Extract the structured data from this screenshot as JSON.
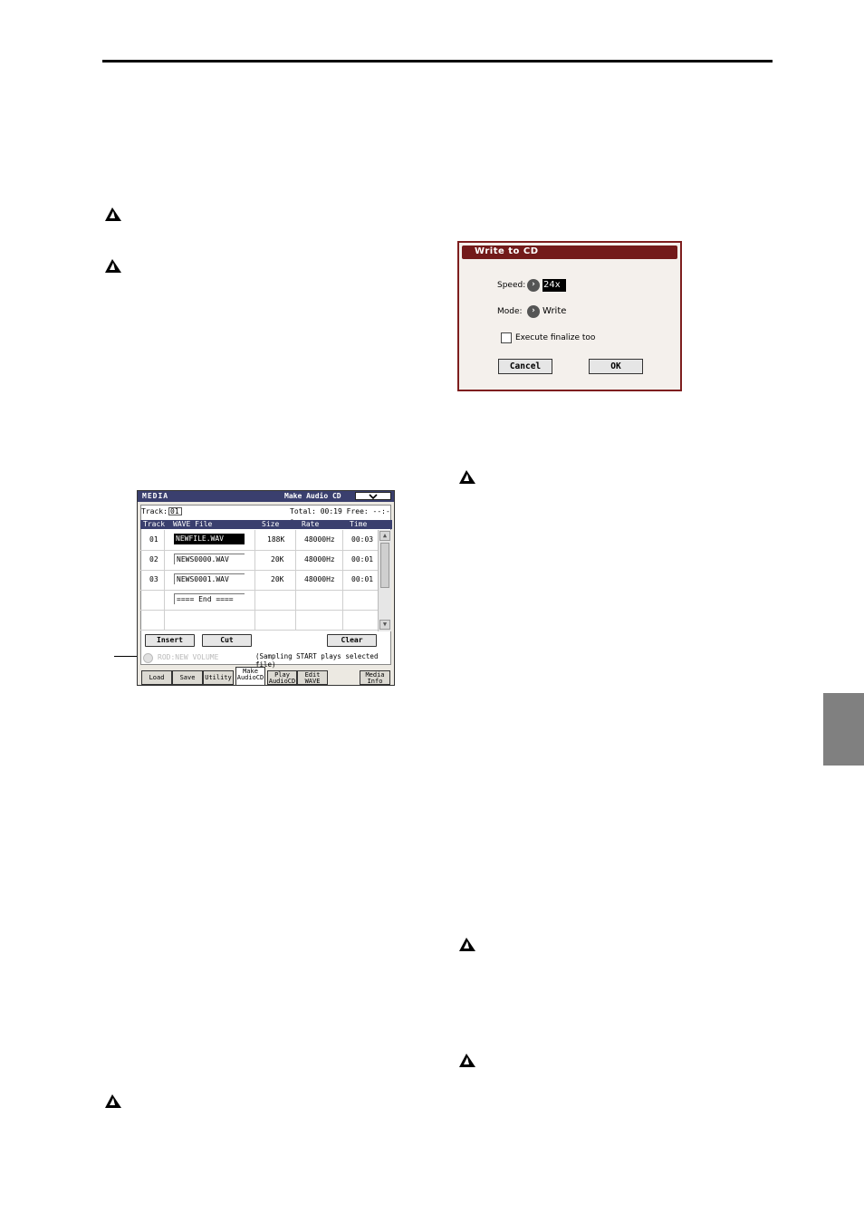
{
  "media_screen": {
    "title": "MEDIA",
    "page_title": "Make Audio CD",
    "track_label": "Track:",
    "track_value": "01",
    "total_text": "Total: 00:19 Free: --:--",
    "columns": [
      "Track",
      "WAVE File",
      "Size",
      "Rate",
      "Time"
    ],
    "rows": [
      {
        "track": "01",
        "file": "NEWFILE.WAV",
        "size": "188K",
        "rate": "48000Hz",
        "time": "00:03"
      },
      {
        "track": "02",
        "file": "NEWS0000.WAV",
        "size": "20K",
        "rate": "48000Hz",
        "time": "00:01"
      },
      {
        "track": "03",
        "file": "NEWS0001.WAV",
        "size": "20K",
        "rate": "48000Hz",
        "time": "00:01"
      }
    ],
    "end_marker": "==== End ====",
    "buttons": {
      "insert": "Insert",
      "cut": "Cut",
      "clear": "Clear"
    },
    "status_left": "ROD:NEW VOLUME",
    "status_right": "(Sampling START plays selected file)",
    "tabs": [
      {
        "label": "Load",
        "active": false
      },
      {
        "label": "Save",
        "active": false
      },
      {
        "label": "Utility",
        "active": false
      },
      {
        "label": "Make AudioCD",
        "active": true
      },
      {
        "label": "Play AudioCD",
        "active": false
      },
      {
        "label": "Edit WAVE",
        "active": false
      },
      {
        "label": "Media Info",
        "active": false
      }
    ]
  },
  "write_dialog": {
    "title": "Write to CD",
    "speed_label": "Speed:",
    "speed_value": "24x",
    "mode_label": "Mode:",
    "mode_value": "Write",
    "finalize_label": "Execute finalize too",
    "finalize_checked": false,
    "cancel_label": "Cancel",
    "ok_label": "OK"
  }
}
